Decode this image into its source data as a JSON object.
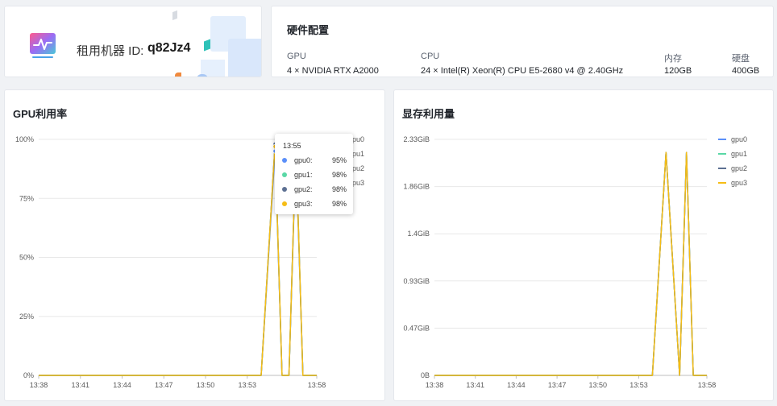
{
  "machine": {
    "label": "租用机器 ID:",
    "id": "q82Jz4"
  },
  "hardware": {
    "title": "硬件配置",
    "columns": [
      {
        "header": "GPU",
        "value": "4 × NVIDIA RTX A2000"
      },
      {
        "header": "CPU",
        "value": "24 × Intel(R) Xeon(R) CPU E5-2680 v4 @ 2.40GHz"
      },
      {
        "header": "内存",
        "value": "120GB"
      },
      {
        "header": "硬盘",
        "value": "400GB"
      }
    ]
  },
  "gpu_chart": {
    "title": "GPU利用率"
  },
  "mem_chart": {
    "title": "显存利用量"
  },
  "tooltip": {
    "time": "13:55",
    "rows": [
      {
        "name": "gpu0:",
        "value": "95%",
        "color": "#5b8ff9"
      },
      {
        "name": "gpu1:",
        "value": "98%",
        "color": "#5ad8a6"
      },
      {
        "name": "gpu2:",
        "value": "98%",
        "color": "#5d7092"
      },
      {
        "name": "gpu3:",
        "value": "98%",
        "color": "#f6bd16"
      }
    ]
  },
  "colors": {
    "gpu0": "#5b8ff9",
    "gpu1": "#5ad8a6",
    "gpu2": "#5d7092",
    "gpu3": "#f6bd16",
    "grid": "#e8e8e8",
    "axis_text": "#595959"
  },
  "chart_data": [
    {
      "type": "line",
      "title": "GPU利用率",
      "x_ticks": [
        "13:38",
        "13:41",
        "13:44",
        "13:47",
        "13:50",
        "13:53",
        "13:58"
      ],
      "y_ticks": [
        "0%",
        "25%",
        "50%",
        "75%",
        "100%"
      ],
      "ylim": [
        0,
        100
      ],
      "x_unit": "minute",
      "x_range": [
        "13:38",
        "13:58"
      ],
      "x": [
        "13:38",
        "13:53",
        "13:54",
        "13:55",
        "13:55.5",
        "13:56",
        "13:56.5",
        "13:57",
        "13:58"
      ],
      "legend": [
        "gpu0",
        "gpu1",
        "gpu2",
        "gpu3"
      ],
      "legend_position": "right",
      "series": [
        {
          "name": "gpu0",
          "values": [
            0,
            0,
            0,
            95,
            0,
            0,
            95,
            0,
            0
          ]
        },
        {
          "name": "gpu1",
          "values": [
            0,
            0,
            0,
            98,
            0,
            0,
            98,
            0,
            0
          ]
        },
        {
          "name": "gpu2",
          "values": [
            0,
            0,
            0,
            98,
            0,
            0,
            98,
            0,
            0
          ]
        },
        {
          "name": "gpu3",
          "values": [
            0,
            0,
            0,
            98,
            0,
            0,
            98,
            0,
            0
          ]
        }
      ]
    },
    {
      "type": "line",
      "title": "显存利用量",
      "x_ticks": [
        "13:38",
        "13:41",
        "13:44",
        "13:47",
        "13:50",
        "13:53",
        "13:58"
      ],
      "y_ticks": [
        "0B",
        "0.47GiB",
        "0.93GiB",
        "1.4GiB",
        "1.86GiB",
        "2.33GiB"
      ],
      "ylim": [
        0,
        2.33
      ],
      "y_unit": "GiB",
      "x_range": [
        "13:38",
        "13:58"
      ],
      "x": [
        "13:38",
        "13:54",
        "13:55",
        "13:56",
        "13:56.5",
        "13:57",
        "13:58"
      ],
      "legend": [
        "gpu0",
        "gpu1",
        "gpu2",
        "gpu3"
      ],
      "legend_position": "top-right",
      "series": [
        {
          "name": "gpu0",
          "values": [
            0,
            0,
            2.2,
            0,
            2.2,
            0,
            0
          ]
        },
        {
          "name": "gpu1",
          "values": [
            0,
            0,
            2.2,
            0,
            2.2,
            0,
            0
          ]
        },
        {
          "name": "gpu2",
          "values": [
            0,
            0,
            2.2,
            0,
            2.2,
            0,
            0
          ]
        },
        {
          "name": "gpu3",
          "values": [
            0,
            0,
            2.2,
            0,
            2.2,
            0,
            0
          ]
        }
      ]
    }
  ]
}
